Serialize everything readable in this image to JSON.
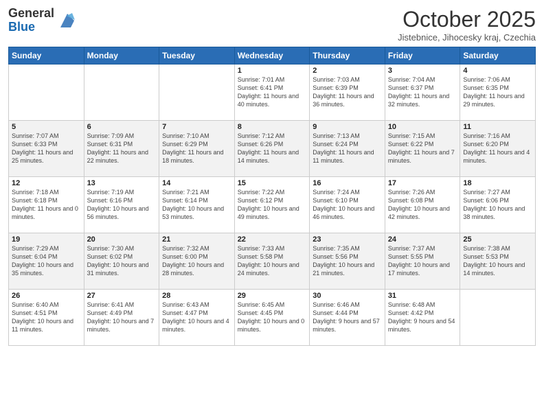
{
  "header": {
    "logo_general": "General",
    "logo_blue": "Blue",
    "month_title": "October 2025",
    "location": "Jistebnice, Jihocesky kraj, Czechia"
  },
  "weekdays": [
    "Sunday",
    "Monday",
    "Tuesday",
    "Wednesday",
    "Thursday",
    "Friday",
    "Saturday"
  ],
  "weeks": [
    [
      {
        "day": "",
        "info": ""
      },
      {
        "day": "",
        "info": ""
      },
      {
        "day": "",
        "info": ""
      },
      {
        "day": "1",
        "info": "Sunrise: 7:01 AM\nSunset: 6:41 PM\nDaylight: 11 hours\nand 40 minutes."
      },
      {
        "day": "2",
        "info": "Sunrise: 7:03 AM\nSunset: 6:39 PM\nDaylight: 11 hours\nand 36 minutes."
      },
      {
        "day": "3",
        "info": "Sunrise: 7:04 AM\nSunset: 6:37 PM\nDaylight: 11 hours\nand 32 minutes."
      },
      {
        "day": "4",
        "info": "Sunrise: 7:06 AM\nSunset: 6:35 PM\nDaylight: 11 hours\nand 29 minutes."
      }
    ],
    [
      {
        "day": "5",
        "info": "Sunrise: 7:07 AM\nSunset: 6:33 PM\nDaylight: 11 hours\nand 25 minutes."
      },
      {
        "day": "6",
        "info": "Sunrise: 7:09 AM\nSunset: 6:31 PM\nDaylight: 11 hours\nand 22 minutes."
      },
      {
        "day": "7",
        "info": "Sunrise: 7:10 AM\nSunset: 6:29 PM\nDaylight: 11 hours\nand 18 minutes."
      },
      {
        "day": "8",
        "info": "Sunrise: 7:12 AM\nSunset: 6:26 PM\nDaylight: 11 hours\nand 14 minutes."
      },
      {
        "day": "9",
        "info": "Sunrise: 7:13 AM\nSunset: 6:24 PM\nDaylight: 11 hours\nand 11 minutes."
      },
      {
        "day": "10",
        "info": "Sunrise: 7:15 AM\nSunset: 6:22 PM\nDaylight: 11 hours\nand 7 minutes."
      },
      {
        "day": "11",
        "info": "Sunrise: 7:16 AM\nSunset: 6:20 PM\nDaylight: 11 hours\nand 4 minutes."
      }
    ],
    [
      {
        "day": "12",
        "info": "Sunrise: 7:18 AM\nSunset: 6:18 PM\nDaylight: 11 hours\nand 0 minutes."
      },
      {
        "day": "13",
        "info": "Sunrise: 7:19 AM\nSunset: 6:16 PM\nDaylight: 10 hours\nand 56 minutes."
      },
      {
        "day": "14",
        "info": "Sunrise: 7:21 AM\nSunset: 6:14 PM\nDaylight: 10 hours\nand 53 minutes."
      },
      {
        "day": "15",
        "info": "Sunrise: 7:22 AM\nSunset: 6:12 PM\nDaylight: 10 hours\nand 49 minutes."
      },
      {
        "day": "16",
        "info": "Sunrise: 7:24 AM\nSunset: 6:10 PM\nDaylight: 10 hours\nand 46 minutes."
      },
      {
        "day": "17",
        "info": "Sunrise: 7:26 AM\nSunset: 6:08 PM\nDaylight: 10 hours\nand 42 minutes."
      },
      {
        "day": "18",
        "info": "Sunrise: 7:27 AM\nSunset: 6:06 PM\nDaylight: 10 hours\nand 38 minutes."
      }
    ],
    [
      {
        "day": "19",
        "info": "Sunrise: 7:29 AM\nSunset: 6:04 PM\nDaylight: 10 hours\nand 35 minutes."
      },
      {
        "day": "20",
        "info": "Sunrise: 7:30 AM\nSunset: 6:02 PM\nDaylight: 10 hours\nand 31 minutes."
      },
      {
        "day": "21",
        "info": "Sunrise: 7:32 AM\nSunset: 6:00 PM\nDaylight: 10 hours\nand 28 minutes."
      },
      {
        "day": "22",
        "info": "Sunrise: 7:33 AM\nSunset: 5:58 PM\nDaylight: 10 hours\nand 24 minutes."
      },
      {
        "day": "23",
        "info": "Sunrise: 7:35 AM\nSunset: 5:56 PM\nDaylight: 10 hours\nand 21 minutes."
      },
      {
        "day": "24",
        "info": "Sunrise: 7:37 AM\nSunset: 5:55 PM\nDaylight: 10 hours\nand 17 minutes."
      },
      {
        "day": "25",
        "info": "Sunrise: 7:38 AM\nSunset: 5:53 PM\nDaylight: 10 hours\nand 14 minutes."
      }
    ],
    [
      {
        "day": "26",
        "info": "Sunrise: 6:40 AM\nSunset: 4:51 PM\nDaylight: 10 hours\nand 11 minutes."
      },
      {
        "day": "27",
        "info": "Sunrise: 6:41 AM\nSunset: 4:49 PM\nDaylight: 10 hours\nand 7 minutes."
      },
      {
        "day": "28",
        "info": "Sunrise: 6:43 AM\nSunset: 4:47 PM\nDaylight: 10 hours\nand 4 minutes."
      },
      {
        "day": "29",
        "info": "Sunrise: 6:45 AM\nSunset: 4:45 PM\nDaylight: 10 hours\nand 0 minutes."
      },
      {
        "day": "30",
        "info": "Sunrise: 6:46 AM\nSunset: 4:44 PM\nDaylight: 9 hours\nand 57 minutes."
      },
      {
        "day": "31",
        "info": "Sunrise: 6:48 AM\nSunset: 4:42 PM\nDaylight: 9 hours\nand 54 minutes."
      },
      {
        "day": "",
        "info": ""
      }
    ]
  ]
}
